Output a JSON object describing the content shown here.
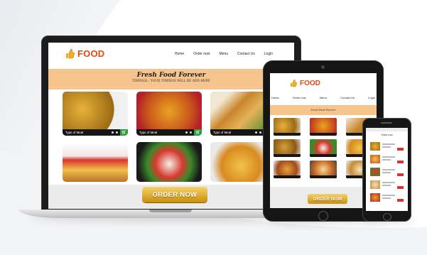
{
  "site": {
    "brand": "FOOD",
    "nav": [
      "Home",
      "Order now",
      "Menu",
      "Contact Us",
      "Login"
    ],
    "hero_title": "Fresh Food Forever",
    "hero_subtitle": "TIMINGS : YOUR TIMINGS WILL BE ADD HERE",
    "tile_label": "Type of Meal",
    "order_button": "ORDER NOW"
  },
  "colors": {
    "brand_orange": "#e04a12",
    "hero_peach": "#f6c48c",
    "order_gold": "#e0a823",
    "cart_green": "#2f9e3a",
    "device_black": "#161616"
  },
  "icons": {
    "logo": "thumbs-up-icon",
    "cart": "cart-icon"
  }
}
